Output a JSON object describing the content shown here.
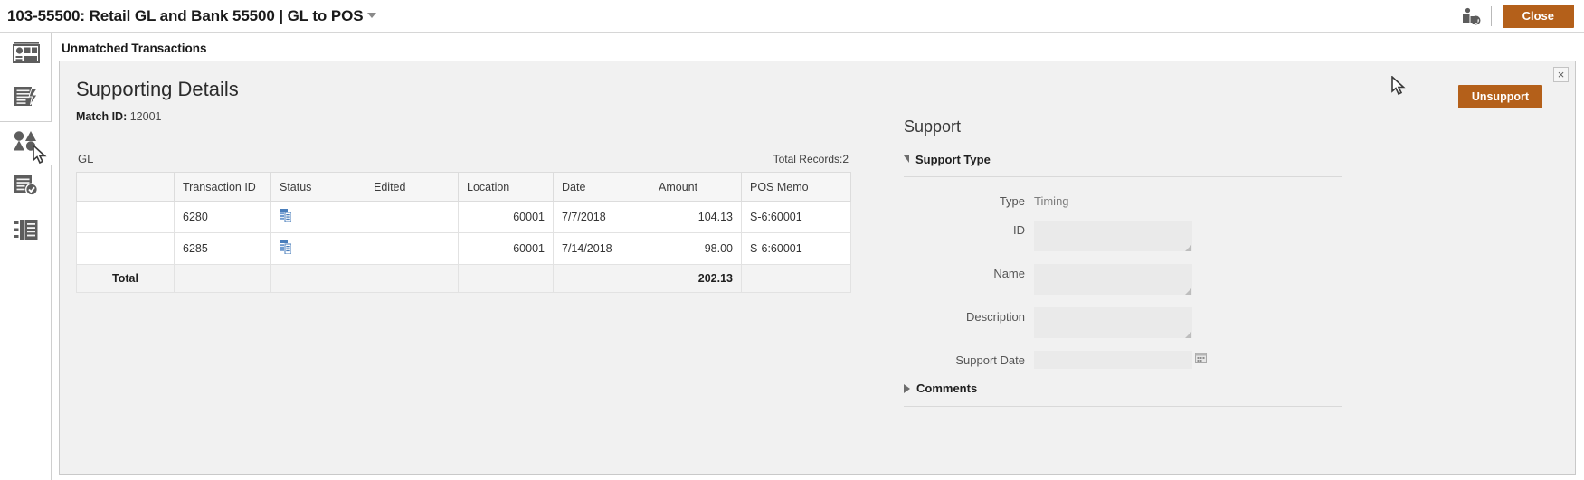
{
  "topbar": {
    "title": "103-55500: Retail GL and Bank 55500 | GL to POS",
    "caret_icon": "chevron-down-icon",
    "user_icon": "user-restricted-icon",
    "close_label": "Close"
  },
  "sidebar": {
    "items": [
      {
        "icon": "dashboard-icon",
        "name": "sidebar-item-dashboard",
        "active": false
      },
      {
        "icon": "report-lightning-icon",
        "name": "sidebar-item-reports",
        "active": false
      },
      {
        "icon": "matching-shapes-icon",
        "name": "sidebar-item-matching",
        "active": true
      },
      {
        "icon": "document-check-icon",
        "name": "sidebar-item-reconciliation",
        "active": false
      },
      {
        "icon": "list-panel-icon",
        "name": "sidebar-item-transactions",
        "active": false
      }
    ]
  },
  "page": {
    "section_title": "Unmatched Transactions"
  },
  "panel": {
    "title": "Supporting Details",
    "match_id_label": "Match ID:",
    "match_id_value": "12001",
    "unsupport_label": "Unsupport",
    "close_icon": "close-icon",
    "close_glyph": "×"
  },
  "gl": {
    "group_label": "GL",
    "total_records_label": "Total Records:2",
    "columns": [
      "",
      "Transaction ID",
      "Status",
      "Edited",
      "Location",
      "Date",
      "Amount",
      "POS Memo"
    ],
    "rows": [
      {
        "select": "",
        "transaction_id": "6280",
        "status_icon": "transaction-detail-icon",
        "edited": "",
        "location": "60001",
        "date": "7/7/2018",
        "amount": "104.13",
        "pos_memo": "S-6:60001"
      },
      {
        "select": "",
        "transaction_id": "6285",
        "status_icon": "transaction-detail-icon",
        "edited": "",
        "location": "60001",
        "date": "7/14/2018",
        "amount": "98.00",
        "pos_memo": "S-6:60001"
      }
    ],
    "total_row": {
      "label": "Total",
      "transaction_id": "",
      "status": "",
      "edited": "",
      "location": "",
      "date": "",
      "amount": "202.13",
      "pos_memo": ""
    }
  },
  "support": {
    "title": "Support",
    "support_type_section": {
      "label": "Support Type",
      "expanded": true,
      "expand_icon": "triangle-down-icon"
    },
    "fields": [
      {
        "label": "Type",
        "value": "Timing",
        "kind": "text"
      },
      {
        "label": "ID",
        "value": "",
        "kind": "textarea"
      },
      {
        "label": "Name",
        "value": "",
        "kind": "textarea"
      },
      {
        "label": "Description",
        "value": "",
        "kind": "textarea"
      },
      {
        "label": "Support Date",
        "value": "",
        "kind": "date",
        "icon": "calendar-icon"
      }
    ],
    "comments_section": {
      "label": "Comments",
      "expanded": false,
      "expand_icon": "triangle-right-icon"
    }
  },
  "colors": {
    "accent": "#b4601a",
    "panel_bg": "#f1f1f1",
    "border": "#c9c9c9",
    "status_icon": "#4a7ebb"
  }
}
